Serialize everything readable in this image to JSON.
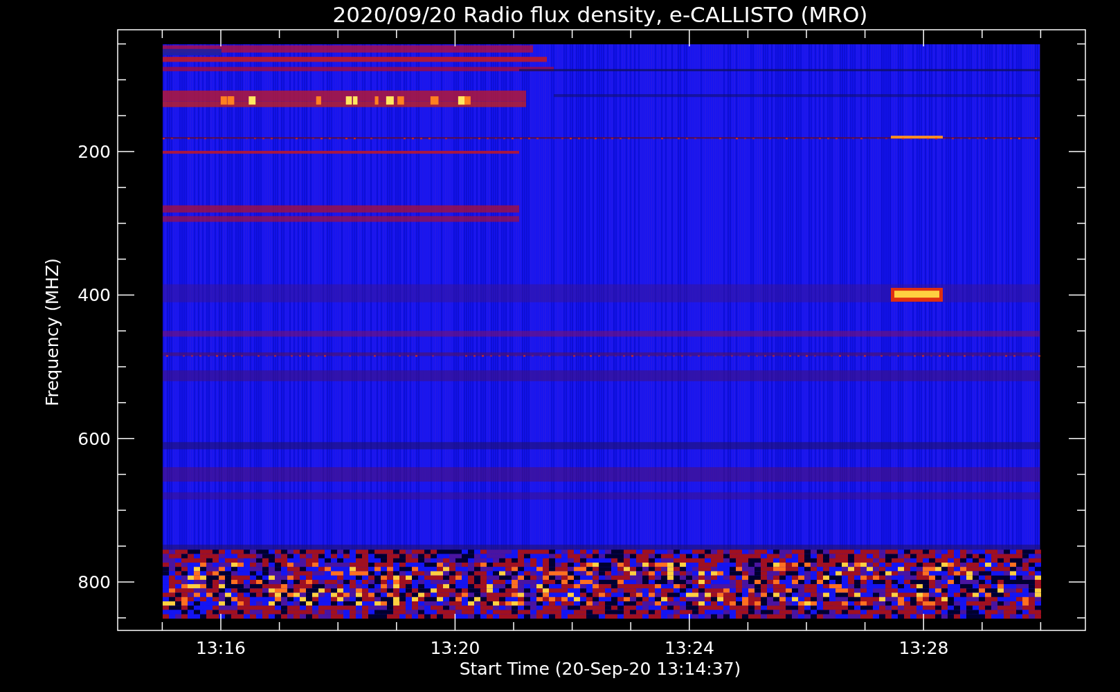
{
  "title": "2020/09/20  Radio flux density, e-CALLISTO (MRO)",
  "ylabel": "Frequency (MHZ)",
  "xlabel": "Start Time (20-Sep-20 13:14:37)",
  "yticks": [
    "200",
    "400",
    "600",
    "800"
  ],
  "xticks": [
    "13:16",
    "13:20",
    "13:24",
    "13:28"
  ]
}
